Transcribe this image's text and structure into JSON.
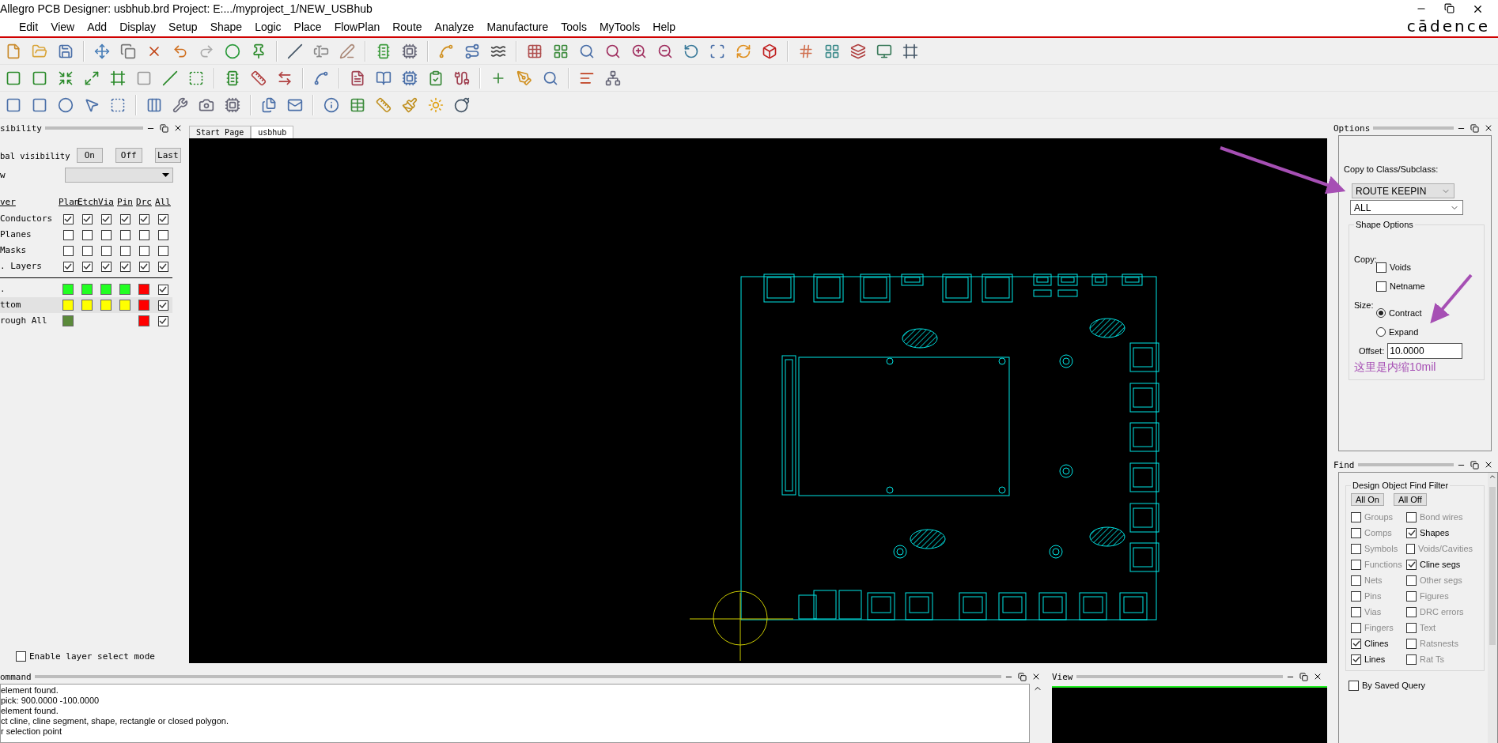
{
  "window": {
    "title": "Allegro PCB Designer: usbhub.brd  Project: E:.../myproject_1/NEW_USBhub",
    "logo": "cādence"
  },
  "menu": [
    "Edit",
    "View",
    "Add",
    "Display",
    "Setup",
    "Shape",
    "Logic",
    "Place",
    "FlowPlan",
    "Route",
    "Analyze",
    "Manufacture",
    "Tools",
    "MyTools",
    "Help"
  ],
  "visibility": {
    "title": "sibility",
    "global_label": "bal visibility",
    "buttons": [
      "On",
      "Off",
      "Last"
    ],
    "view_label": "w",
    "columns": [
      "ver",
      "Plan",
      "Etch",
      "Via",
      "Pin",
      "Drc",
      "All"
    ],
    "groups": [
      {
        "label": "Conductors",
        "checks": [
          true,
          true,
          true,
          true,
          true,
          true
        ]
      },
      {
        "label": "Planes",
        "checks": [
          false,
          false,
          false,
          false,
          false,
          false
        ]
      },
      {
        "label": "Masks",
        "checks": [
          false,
          false,
          false,
          false,
          false,
          false
        ]
      },
      {
        "label": ". Layers",
        "checks": [
          true,
          true,
          true,
          true,
          true,
          true
        ]
      }
    ],
    "layers": [
      {
        "label": ".",
        "selected": false,
        "all": true,
        "cells": [
          {
            "kind": "swatch",
            "color": "#22ff22"
          },
          {
            "kind": "swatch",
            "color": "#22ff22"
          },
          {
            "kind": "swatch",
            "color": "#22ff22"
          },
          {
            "kind": "swatch",
            "color": "#22ff22"
          },
          {
            "kind": "swatch",
            "color": "#ff0000"
          }
        ]
      },
      {
        "label": "ttom",
        "selected": true,
        "all": true,
        "cells": [
          {
            "kind": "swatch",
            "color": "#ffff00"
          },
          {
            "kind": "swatch",
            "color": "#ffff00"
          },
          {
            "kind": "swatch",
            "color": "#ffff00"
          },
          {
            "kind": "swatch",
            "color": "#ffff00"
          },
          {
            "kind": "swatch",
            "color": "#ff0000"
          }
        ]
      },
      {
        "label": "rough All",
        "selected": false,
        "all": true,
        "cells": [
          {
            "kind": "swatch",
            "color": "#5b8a3a"
          },
          {
            "kind": "blank"
          },
          {
            "kind": "blank"
          },
          {
            "kind": "blank"
          },
          {
            "kind": "swatch",
            "color": "#ff0000"
          }
        ]
      }
    ],
    "layer_select": {
      "label": "Enable layer select mode",
      "checked": false
    }
  },
  "tabs": [
    {
      "label": "Start Page",
      "selected": false
    },
    {
      "label": "usbhub",
      "selected": true
    }
  ],
  "options": {
    "title": "Options",
    "copy_to_label": "Copy to Class/Subclass:",
    "class_value": "ROUTE KEEPIN",
    "subclass_value": "ALL",
    "group_title": "Shape Options",
    "copy_label": "Copy:",
    "copy_items": [
      {
        "label": "Voids",
        "checked": false
      },
      {
        "label": "Netname",
        "checked": false
      }
    ],
    "size_label": "Size:",
    "size_items": [
      {
        "label": "Contract",
        "selected": true
      },
      {
        "label": "Expand",
        "selected": false
      }
    ],
    "offset_label": "Offset:",
    "offset_value": "10.0000",
    "note": "这里是内缩10mil"
  },
  "find": {
    "title": "Find",
    "group_title": "Design Object Find Filter",
    "buttons": [
      "All On",
      "All Off"
    ],
    "items": [
      {
        "label": "Groups",
        "checked": false
      },
      {
        "label": "Bond wires",
        "checked": false
      },
      {
        "label": "Comps",
        "checked": false
      },
      {
        "label": "Shapes",
        "checked": true
      },
      {
        "label": "Symbols",
        "checked": false
      },
      {
        "label": "Voids/Cavities",
        "checked": false
      },
      {
        "label": "Functions",
        "checked": false
      },
      {
        "label": "Cline segs",
        "checked": true
      },
      {
        "label": "Nets",
        "checked": false
      },
      {
        "label": "Other segs",
        "checked": false
      },
      {
        "label": "Pins",
        "checked": false
      },
      {
        "label": "Figures",
        "checked": false
      },
      {
        "label": "Vias",
        "checked": false
      },
      {
        "label": "DRC errors",
        "checked": false
      },
      {
        "label": "Fingers",
        "checked": false
      },
      {
        "label": "Text",
        "checked": false
      },
      {
        "label": "Clines",
        "checked": true
      },
      {
        "label": "Ratsnests",
        "checked": false
      },
      {
        "label": "Lines",
        "checked": true
      },
      {
        "label": "Rat Ts",
        "checked": false
      }
    ],
    "saved_query": {
      "label": "By Saved Query",
      "checked": false
    }
  },
  "command": {
    "title": "ommand",
    "lines": [
      "element found.",
      "pick:  900.0000 -100.0000",
      "element found.",
      "ct cline, cline segment, shape, rectangle or closed polygon.",
      "r selection point"
    ]
  },
  "view": {
    "title": "View"
  }
}
